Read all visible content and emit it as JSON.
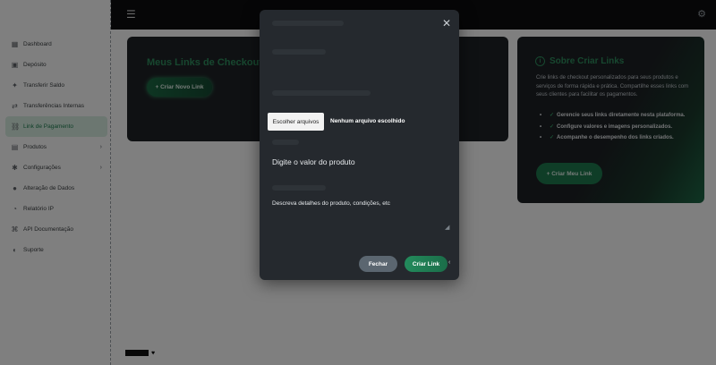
{
  "sidebar": {
    "items": [
      {
        "icon": "bars-icon",
        "glyph": "▦",
        "label": "Dashboard"
      },
      {
        "icon": "calendar-icon",
        "glyph": "▣",
        "label": "Depósito"
      },
      {
        "icon": "star-icon",
        "glyph": "✦",
        "label": "Transferir Saldo"
      },
      {
        "icon": "transfer-icon",
        "glyph": "⇄",
        "label": "Transferências Internas"
      },
      {
        "icon": "link-icon",
        "glyph": "⛓",
        "label": "Link de Pagamento"
      },
      {
        "icon": "cart-icon",
        "glyph": "▤",
        "label": "Produtos"
      },
      {
        "icon": "gear-icon",
        "glyph": "✱",
        "label": "Configurações"
      },
      {
        "icon": "user-icon",
        "glyph": "●",
        "label": "Alteração de Dados"
      },
      {
        "icon": "clock-icon",
        "glyph": "◔",
        "label": "Relatório IP"
      },
      {
        "icon": "api-icon",
        "glyph": "⌘",
        "label": "API Documentação"
      },
      {
        "icon": "help-icon",
        "glyph": "◐",
        "label": "Suporte"
      }
    ]
  },
  "topbar": {
    "menu_icon": "☰",
    "right_icon": "⚙"
  },
  "main_card": {
    "title": "Meus Links de Checkout",
    "new_button": "+ Criar Novo Link"
  },
  "side_card": {
    "title": "Sobre Criar Links",
    "description": "Crie links de checkout personalizados para seus produtos e serviços de forma rápida e prática. Compartilhe esses links com seus clientes para facilitar os pagamentos.",
    "features": [
      "Gerencie seus links diretamente nesta plataforma.",
      "Configure valores e imagens personalizados.",
      "Acompanhe o desempenho dos links criados."
    ],
    "button": "+ Criar Meu Link"
  },
  "modal": {
    "file_button": "Escolher arquivos",
    "file_status": "Nenhum arquivo escolhido",
    "value_placeholder": "Digite o valor do produto",
    "description_placeholder": "Descreva detalhes do produto, condições, etc",
    "close_button": "Fechar",
    "submit_button": "Criar Link"
  },
  "footer": {
    "brand": "♥"
  },
  "colors": {
    "accent": "#2f8f5e",
    "modal_bg": "#25292e",
    "topbar_bg": "#0c0d0f"
  }
}
